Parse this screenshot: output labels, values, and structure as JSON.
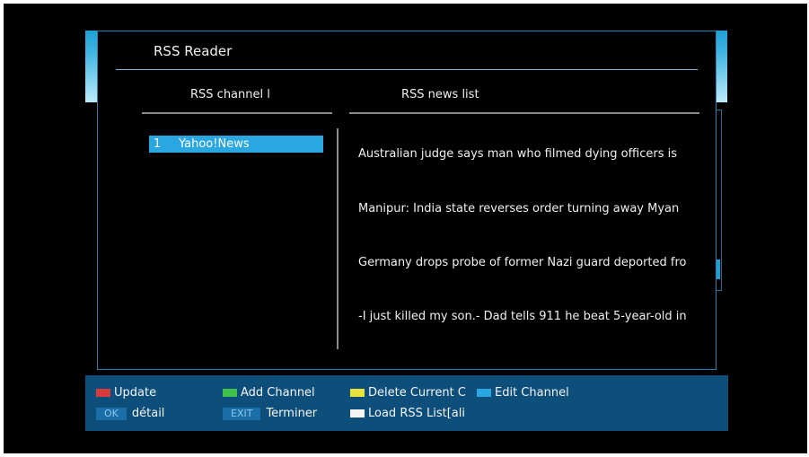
{
  "window": {
    "title": "RSS Reader"
  },
  "columns": {
    "channels_header": "RSS channel l",
    "news_header": "RSS news list"
  },
  "channels": [
    {
      "number": "1",
      "name": "Yahoo!News",
      "selected": true
    }
  ],
  "news": [
    "Australian judge says man who filmed dying officers is",
    "Manipur: India state reverses order turning away Myan",
    "Germany drops probe of former Nazi guard deported fro",
    "-I just killed my son.- Dad tells 911 he beat 5-year-old in"
  ],
  "footer": {
    "update_label": "Update",
    "add_channel_label": "Add Channel",
    "delete_current_label": "Delete Current C",
    "edit_channel_label": "Edit Channel",
    "ok_key": "OK",
    "ok_label": "détail",
    "exit_key": "EXIT",
    "exit_label": "Terminer",
    "load_list_label": "Load RSS List[ali"
  },
  "colors": {
    "panel_border": "#2a7db0",
    "highlight": "#2aa7e0",
    "footer_bg": "#0d4f7a",
    "red_key": "#d93a3a",
    "green_key": "#3ec24a",
    "yellow_key": "#e8e23a",
    "blue_key": "#2aa7e0"
  },
  "icons": {
    "red": "red-key-icon",
    "green": "green-key-icon",
    "yellow": "yellow-key-icon",
    "blue": "blue-key-icon",
    "white": "white-key-icon"
  }
}
